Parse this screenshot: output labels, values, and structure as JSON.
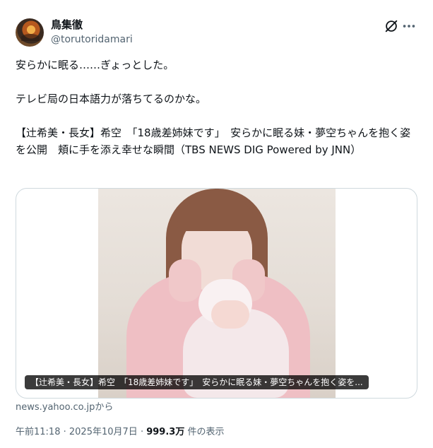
{
  "author": {
    "display_name": "鳥集徹",
    "handle": "@torutoridamari"
  },
  "header_icons": {
    "grok": "grok-icon",
    "more": "more-options-icon"
  },
  "tweet": {
    "text": "安らかに眠る……ぎょっとした。\n\nテレビ局の日本語力が落ちてるのかな。\n\n【辻希美・長女】希空　「18歳差姉妹です」　安らかに眠る妹・夢空ちゃんを抱く姿を公開　頬に手を添え幸せな瞬間（TBS NEWS DIG Powered by JNN）"
  },
  "card": {
    "caption": "【辻希美・長女】希空　「18歳差姉妹です」　安らかに眠る妹・夢空ちゃんを抱く姿を...",
    "source": "news.yahoo.co.jpから"
  },
  "meta": {
    "time": "午前11:18",
    "separator": "·",
    "date": "2025年10月7日",
    "views_count": "999.3万",
    "views_label": "件の表示"
  },
  "colors": {
    "text": "#0f1419",
    "secondary": "#536471",
    "border": "#cfd9de"
  }
}
